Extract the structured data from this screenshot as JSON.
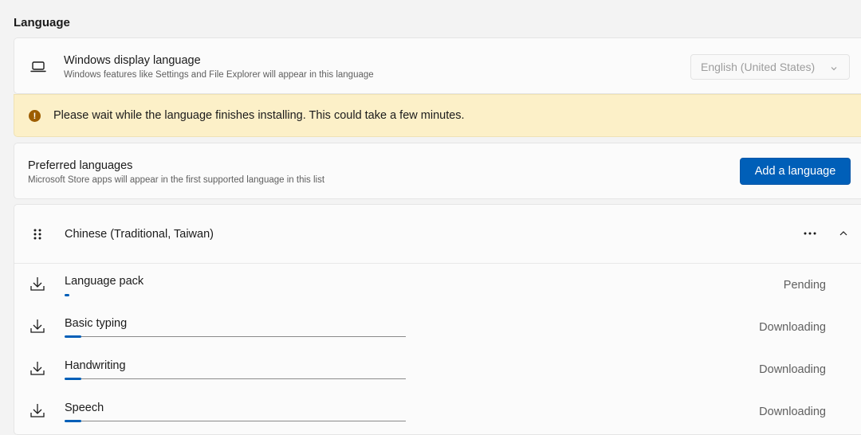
{
  "section_title": "Language",
  "display_language": {
    "title": "Windows display language",
    "subtitle": "Windows features like Settings and File Explorer will appear in this language",
    "selected": "English (United States)",
    "icon": "laptop-icon"
  },
  "info_bar": {
    "message": "Please wait while the language finishes installing. This could take a few minutes.",
    "icon": "warning-icon",
    "icon_color": "#9d5d00",
    "background": "#fcf0c8"
  },
  "preferred": {
    "title": "Preferred languages",
    "subtitle": "Microsoft Store apps will appear in the first supported language in this list",
    "button_label": "Add a language",
    "accent": "#005fb8"
  },
  "language_item": {
    "name": "Chinese (Traditional, Taiwan)",
    "features": [
      {
        "name": "Language pack",
        "status": "Pending",
        "progress": 0.0
      },
      {
        "name": "Basic typing",
        "status": "Downloading",
        "progress": 0.05
      },
      {
        "name": "Handwriting",
        "status": "Downloading",
        "progress": 0.05
      },
      {
        "name": "Speech",
        "status": "Downloading",
        "progress": 0.05
      }
    ]
  }
}
